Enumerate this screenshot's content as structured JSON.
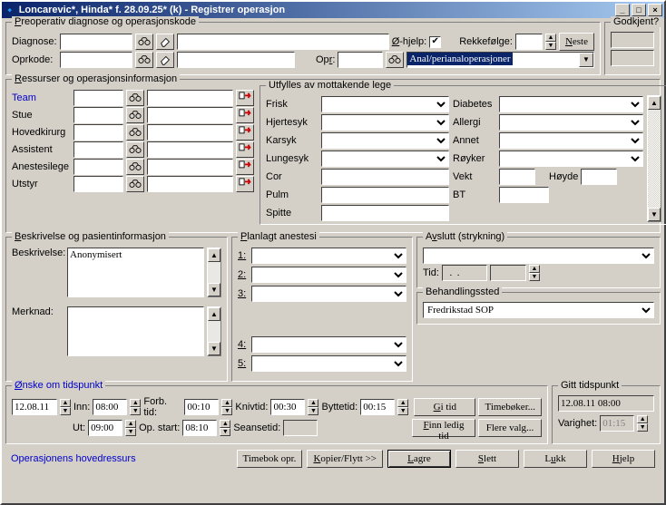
{
  "window": {
    "title": "Loncarevic*, Hinda* f. 28.09.25* (k) - Registrer operasjon",
    "min": "0",
    "max": "1",
    "close": "r"
  },
  "preop": {
    "legend": "Preoperativ diagnose og operasjonskode",
    "diagnose_lbl": "Diagnose:",
    "oprkode_lbl": "Oprkode:",
    "ohjelp_lbl": "Ø-hjelp:",
    "rekkefolge_lbl": "Rekkefølge:",
    "neste_btn": "Neste",
    "opr_lbl": "Opr:",
    "dropdown_value": "Anal/perianaloperasjoner"
  },
  "godkjent": {
    "legend": "Godkjent?"
  },
  "ressurser": {
    "legend": "Ressurser og operasjonsinformasjon",
    "rows": [
      "Team",
      "Stue",
      "Hovedkirurg",
      "Assistent",
      "Anestesilege",
      "Utstyr"
    ]
  },
  "mottakende": {
    "legend": "Utfylles av mottakende lege",
    "left": [
      "Frisk",
      "Hjertesyk",
      "Karsyk",
      "Lungesyk",
      "Cor",
      "Pulm",
      "Spitte"
    ],
    "right_lbl": [
      "Diabetes",
      "Allergi",
      "Annet",
      "Røyker",
      "Vekt",
      "BT"
    ],
    "hoyde_lbl": "Høyde"
  },
  "beskriv": {
    "legend": "Beskrivelse og pasientinformasjon",
    "beskrivelse_lbl": "Beskrivelse:",
    "beskrivelse_val": "Anonymisert",
    "merknad_lbl": "Merknad:"
  },
  "anestesi": {
    "legend": "Planlagt anestesi",
    "nums": [
      "1:",
      "2:",
      "3:",
      "4:",
      "5:"
    ]
  },
  "avslutt": {
    "legend": "Avslutt (strykning)",
    "tid_lbl": "Tid:"
  },
  "behandlingssted": {
    "legend": "Behandlingssted",
    "value": "Fredrikstad SOP"
  },
  "onske": {
    "legend": "Ønske om tidspunkt",
    "date": "12.08.11",
    "inn_lbl": "Inn:",
    "inn": "08:00",
    "ut_lbl": "Ut:",
    "ut": "09:00",
    "forb_lbl": "Forb. tid:",
    "forb": "00:10",
    "opstart_lbl": "Op. start:",
    "opstart": "08:10",
    "kniv_lbl": "Knivtid:",
    "kniv": "00:30",
    "sean_lbl": "Seansetid:",
    "bytt_lbl": "Byttetid:",
    "bytt": "00:15",
    "gi_tid": "Gi tid",
    "timeboker": "Timebøker...",
    "finn": "Finn ledig tid",
    "flere": "Flere valg..."
  },
  "gitt": {
    "legend": "Gitt tidspunkt",
    "value": "12.08.11 08:00",
    "varighet_lbl": "Varighet:",
    "varighet": "01:15"
  },
  "bottom": {
    "link": "Operasjonens hovedressurs",
    "timebok": "Timebok opr.",
    "kopier": "Kopier/Flytt >>",
    "lagre": "Lagre",
    "slett": "Slett",
    "lukk": "Lukk",
    "hjelp": "Hjelp"
  }
}
